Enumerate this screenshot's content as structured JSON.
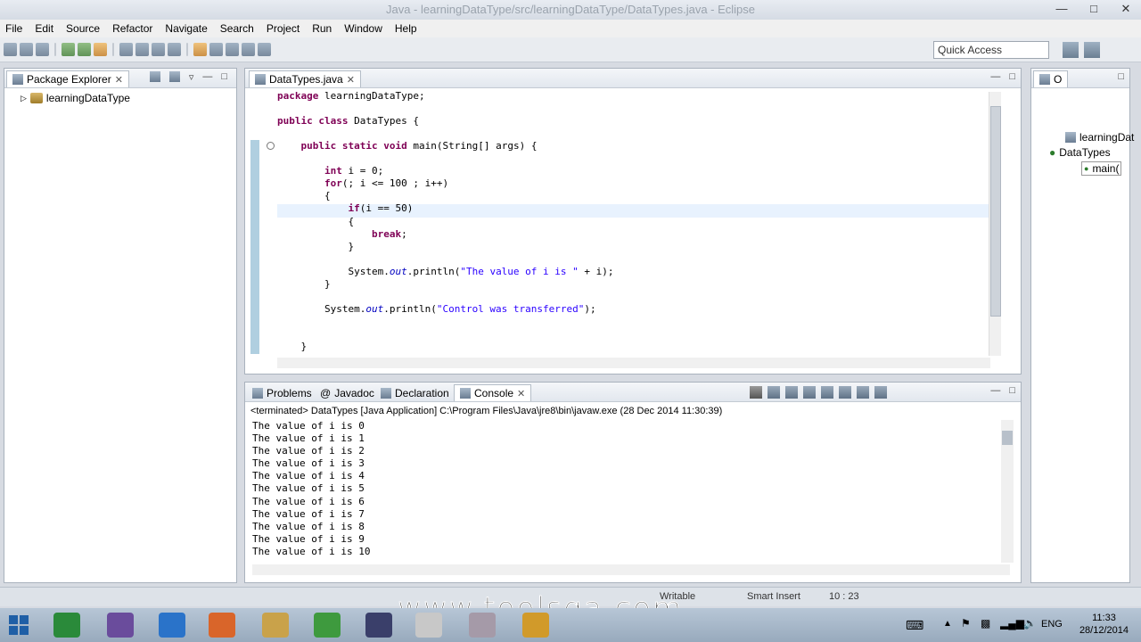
{
  "window": {
    "title": "Java - learningDataType/src/learningDataType/DataTypes.java - Eclipse"
  },
  "menu": [
    "File",
    "Edit",
    "Source",
    "Refactor",
    "Navigate",
    "Search",
    "Project",
    "Run",
    "Window",
    "Help"
  ],
  "toolbar": {
    "quick_access_placeholder": "Quick Access"
  },
  "package_explorer": {
    "tab": "Package Explorer",
    "project": "learningDataType"
  },
  "editor": {
    "tab": "DataTypes.java",
    "lines": [
      {
        "t": 0,
        "text": "package learningDataType;"
      },
      {
        "t": 2,
        "text": "public class DataTypes {"
      },
      {
        "t": 4,
        "text": "    public static void main(String[] args) {"
      },
      {
        "t": 6,
        "text": "        int i = 0;"
      },
      {
        "t": 7,
        "text": "        for(; i <= 100 ; i++)"
      },
      {
        "t": 8,
        "text": "        {"
      },
      {
        "t": 9,
        "text": "            if(i == 50)"
      },
      {
        "t": 10,
        "text": "            {"
      },
      {
        "t": 11,
        "text": "                break;"
      },
      {
        "t": 12,
        "text": "            }"
      },
      {
        "t": 14,
        "text": "            System.out.println(\"The value of i is \" + i);"
      },
      {
        "t": 15,
        "text": "        }"
      },
      {
        "t": 17,
        "text": "        System.out.println(\"Control was transferred\");"
      },
      {
        "t": 20,
        "text": "    }"
      }
    ]
  },
  "console": {
    "tabs": [
      "Problems",
      "Javadoc",
      "Declaration",
      "Console"
    ],
    "terminated": "<terminated> DataTypes [Java Application] C:\\Program Files\\Java\\jre8\\bin\\javaw.exe (28 Dec 2014 11:30:39)",
    "output": [
      "The value of i is 0",
      "The value of i is 1",
      "The value of i is 2",
      "The value of i is 3",
      "The value of i is 4",
      "The value of i is 5",
      "The value of i is 6",
      "The value of i is 7",
      "The value of i is 8",
      "The value of i is 9",
      "The value of i is 10"
    ]
  },
  "outline": {
    "tab": "O",
    "items": [
      "learningDat",
      "DataTypes",
      "main("
    ]
  },
  "status": {
    "writable": "Writable",
    "insert": "Smart Insert",
    "position": "10 : 23"
  },
  "tray": {
    "lang": "ENG",
    "time": "11:33",
    "date": "28/12/2014"
  },
  "watermark": "www.toolsqa.com"
}
